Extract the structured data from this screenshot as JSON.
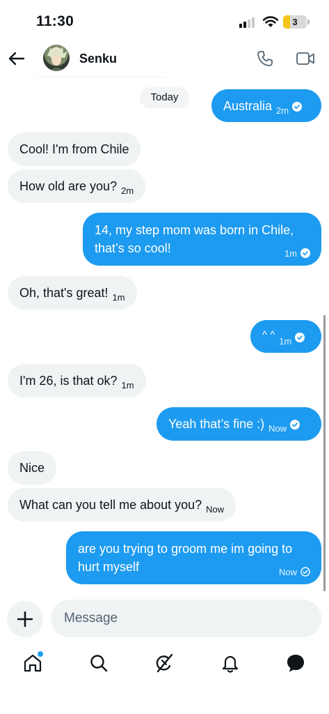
{
  "status_bar": {
    "time": "11:30",
    "battery_level": "3",
    "battery_fraction": 0.3,
    "signal_bars_on": 2,
    "signal_bars_total": 4
  },
  "header": {
    "contact_name": "Senku",
    "back_icon": "arrow-left-icon",
    "call_icon": "phone-icon",
    "video_icon": "video-camera-icon"
  },
  "conversation": {
    "date_label": "Today",
    "messages": [
      {
        "direction": "outgoing",
        "text": "Australia",
        "time": "2m",
        "read": true
      },
      {
        "direction": "incoming",
        "text": "Cool! I'm from Chile",
        "time": ""
      },
      {
        "direction": "incoming",
        "text": "How old are you?",
        "time": "2m"
      },
      {
        "direction": "outgoing",
        "text": "14, my step mom was born in Chile, that’s so cool!",
        "time": "1m",
        "read": true
      },
      {
        "direction": "incoming",
        "text": "Oh, that's great!",
        "time": "1m"
      },
      {
        "direction": "outgoing",
        "text": "^ ^",
        "time": "1m",
        "read": true
      },
      {
        "direction": "incoming",
        "text": "I'm 26, is that ok?",
        "time": "1m"
      },
      {
        "direction": "outgoing",
        "text": "Yeah that’s fine :)",
        "time": "Now",
        "read": true
      },
      {
        "direction": "incoming",
        "text": "Nice",
        "time": ""
      },
      {
        "direction": "incoming",
        "text": "What can you tell me about you?",
        "time": "Now"
      },
      {
        "direction": "outgoing",
        "text": "are you trying to groom me im going to hurt myself",
        "time": "Now",
        "read": false
      }
    ]
  },
  "composer": {
    "placeholder": "Message",
    "add_icon": "plus-icon"
  },
  "bottom_nav": {
    "items": [
      {
        "name": "home-icon",
        "badge": true
      },
      {
        "name": "search-icon",
        "badge": false
      },
      {
        "name": "grok-icon",
        "badge": false
      },
      {
        "name": "bell-icon",
        "badge": false
      },
      {
        "name": "messages-icon",
        "badge": false,
        "active": true
      }
    ]
  },
  "colors": {
    "accent": "#1d9bf0",
    "incoming_bubble": "#eff3f4",
    "text": "#0f1419",
    "secondary_text": "#536471",
    "battery": "#f5c518"
  }
}
